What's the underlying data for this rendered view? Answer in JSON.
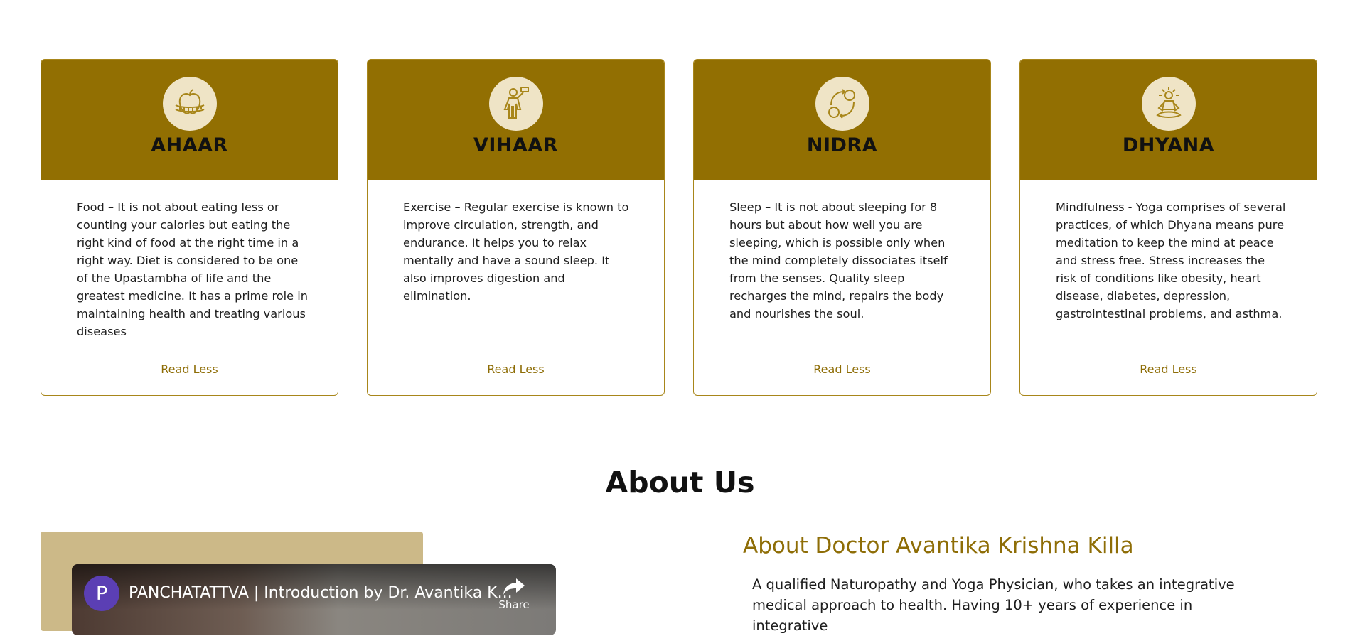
{
  "cards": [
    {
      "title": "AHAAR",
      "icon": "apple-measuring-tape-icon",
      "text": "Food – It is not about eating less or counting your calories but eating the right kind of food at the right time in a right way. Diet is considered to be one of the Upastambha of life and the greatest medicine. It has a prime role in maintaining health and treating various diseases",
      "link": "Read Less"
    },
    {
      "title": "VIHAAR",
      "icon": "exercise-person-icon",
      "text": "Exercise – Regular exercise is known to improve circulation, strength, and endurance. It helps you to relax mentally and have a sound sleep. It also improves digestion and elimination.",
      "link": "Read Less"
    },
    {
      "title": "NIDRA",
      "icon": "sleep-cycle-icon",
      "text": "Sleep – It is not about sleeping for 8 hours but about how well you are sleeping, which is possible only when the mind completely dissociates itself from the senses. Quality sleep recharges the mind, repairs the body and nourishes the soul.",
      "link": "Read Less"
    },
    {
      "title": "DHYANA",
      "icon": "meditation-icon",
      "text": "Mindfulness - Yoga comprises of several practices, of which Dhyana means pure meditation to keep the mind at peace and stress free. Stress increases the risk of conditions like obesity, heart disease, diabetes, depression, gastrointestinal problems, and asthma.",
      "link": "Read Less"
    }
  ],
  "about": {
    "heading": "About Us",
    "subheading": "About Doctor Avantika Krishna Killa",
    "text": "A qualified Naturopathy and Yoga Physician, who takes an integrative medical approach to health. Having 10+ years of experience in integrative",
    "video": {
      "channel_initial": "P",
      "title": "PANCHATATTVA | Introduction by Dr. Avantika K...",
      "share_label": "Share"
    }
  },
  "colors": {
    "accent": "#926f02",
    "icon_bg": "#efe4c6",
    "link": "#8e6d06",
    "video_backdrop": "#ccb988"
  }
}
